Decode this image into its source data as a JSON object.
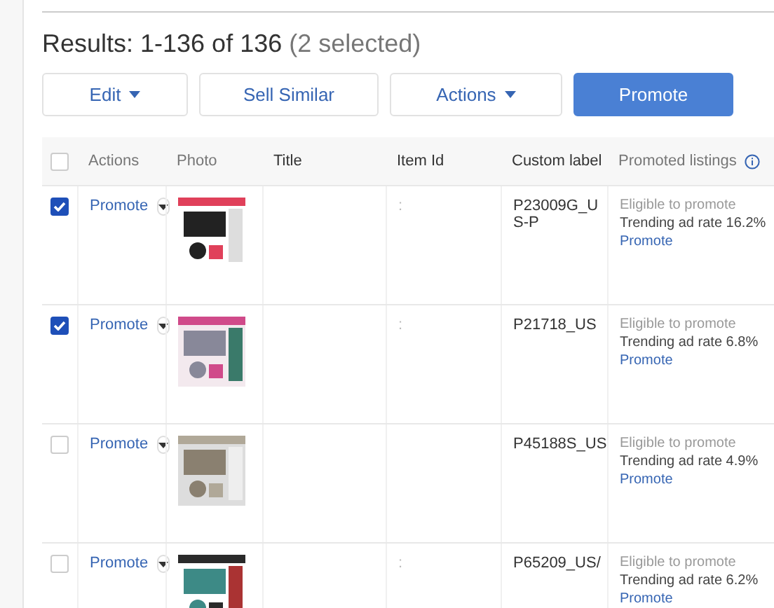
{
  "results": {
    "summary": "Results: 1-136 of 136",
    "selected_note": "(2 selected)"
  },
  "toolbar": [
    {
      "label": "Edit",
      "dropdown": true,
      "primary": false
    },
    {
      "label": "Sell Similar",
      "dropdown": false,
      "primary": false
    },
    {
      "label": "Actions",
      "dropdown": true,
      "primary": false
    },
    {
      "label": "Promote",
      "dropdown": false,
      "primary": true
    }
  ],
  "table": {
    "select_all": {
      "checked": false
    },
    "columns": [
      {
        "label": "Actions"
      },
      {
        "label": "Photo"
      },
      {
        "label": "Title"
      },
      {
        "label": "Item Id"
      },
      {
        "label": "Custom label"
      },
      {
        "label": "Promoted listings",
        "info": true
      }
    ],
    "rows": [
      {
        "checked": true,
        "action": "Promote",
        "item_id": ":",
        "custom_label": "P23009G_US-P",
        "status": "Eligible to promote",
        "rate": "Trending ad rate 16.2%",
        "link": "Promote"
      },
      {
        "checked": true,
        "action": "Promote",
        "item_id": ":",
        "custom_label": "P21718_US",
        "status": "Eligible to promote",
        "rate": "Trending ad rate 6.8%",
        "link": "Promote"
      },
      {
        "checked": false,
        "action": "Promote",
        "custom_label": "P45188S_US",
        "status": "Eligible to promote",
        "rate": "Trending ad rate 4.9%",
        "link": "Promote"
      },
      {
        "checked": false,
        "action": "Promote",
        "item_id": ":",
        "custom_label": "P65209_US/",
        "status": "Eligible to promote",
        "rate": "Trending ad rate 6.2%",
        "link": "Promote"
      }
    ]
  }
}
